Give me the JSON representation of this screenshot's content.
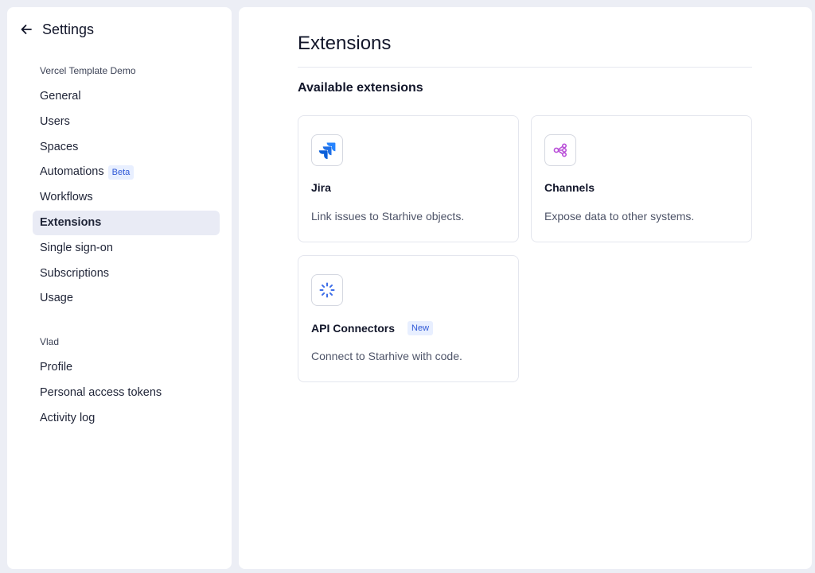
{
  "sidebar": {
    "header": {
      "title": "Settings",
      "back_icon": "arrow-left-icon"
    },
    "groups": [
      {
        "label": "Vercel Template Demo",
        "items": [
          {
            "label": "General"
          },
          {
            "label": "Users"
          },
          {
            "label": "Spaces"
          },
          {
            "label": "Automations",
            "badge": "Beta"
          },
          {
            "label": "Workflows"
          },
          {
            "label": "Extensions",
            "active": true
          },
          {
            "label": "Single sign-on"
          },
          {
            "label": "Subscriptions"
          },
          {
            "label": "Usage"
          }
        ]
      },
      {
        "label": "Vlad",
        "items": [
          {
            "label": "Profile"
          },
          {
            "label": "Personal access tokens"
          },
          {
            "label": "Activity log"
          }
        ]
      }
    ]
  },
  "main": {
    "title": "Extensions",
    "section_title": "Available extensions",
    "cards": [
      {
        "name": "Jira",
        "description": "Link issues to Starhive objects.",
        "icon": "jira-icon"
      },
      {
        "name": "Channels",
        "description": "Expose data to other systems.",
        "icon": "share-nodes-icon"
      },
      {
        "name": "API Connectors",
        "badge": "New",
        "description": "Connect to Starhive with code.",
        "icon": "api-connector-icon"
      }
    ]
  },
  "colors": {
    "background": "#eceef5",
    "panel": "#ffffff",
    "active_nav": "#e9ebf5",
    "badge_bg": "#e8efff",
    "badge_text": "#2f58d6",
    "jira_blue": "#2684ff",
    "channels_purple": "#b94fd8",
    "connector_blue": "#3e6ee8"
  }
}
